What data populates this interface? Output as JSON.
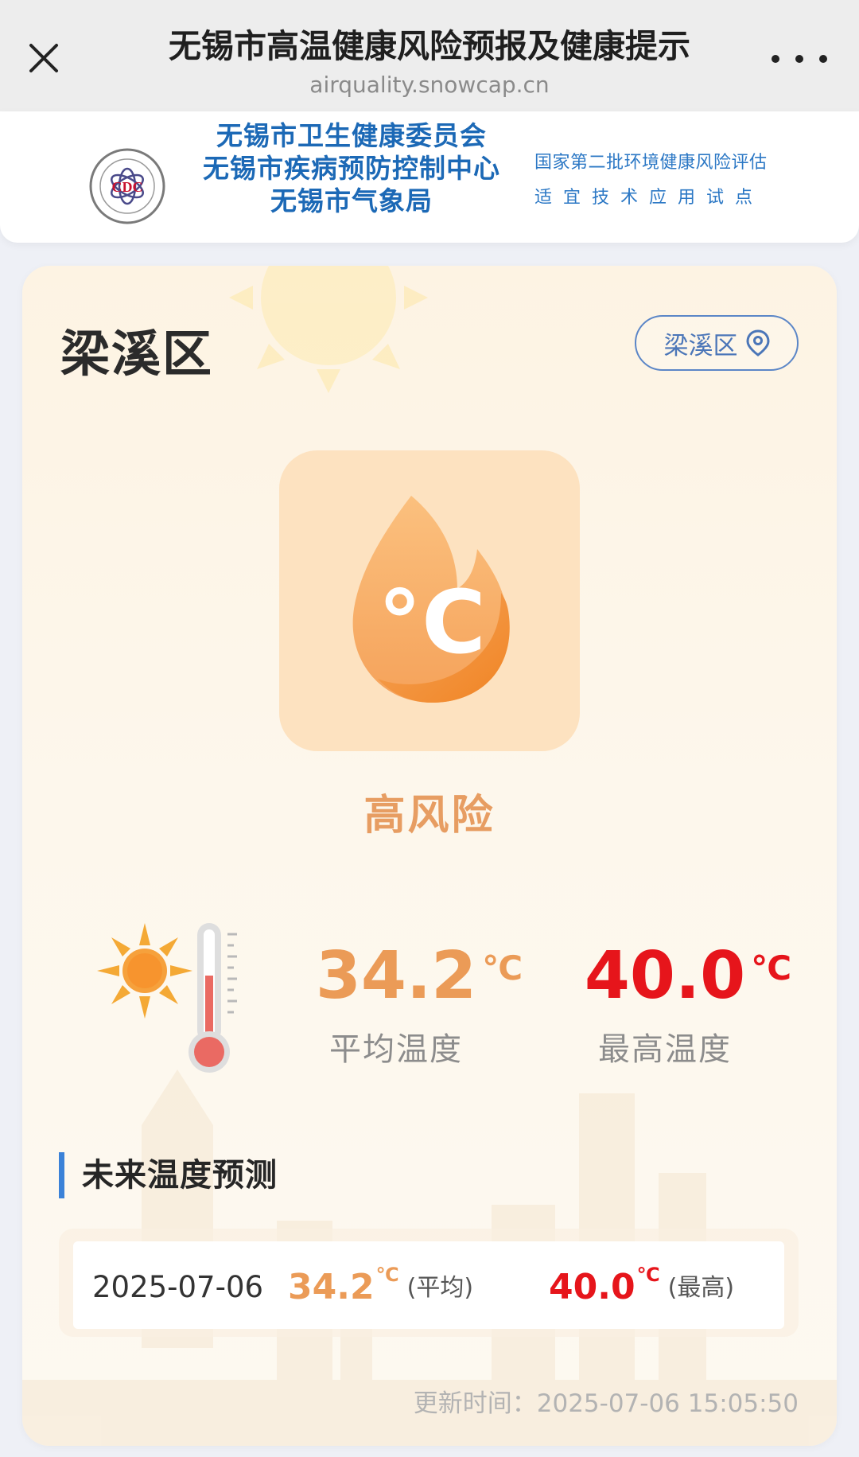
{
  "nav": {
    "title": "无锡市高温健康风险预报及健康提示",
    "url": "airquality.snowcap.cn"
  },
  "banner": {
    "orgs": [
      "无锡市卫生健康委员会",
      "无锡市疾病预防控制中心",
      "无锡市气象局"
    ],
    "pilot_line1": "国家第二批环境健康风险评估",
    "pilot_line2": "适宜技术应用试点",
    "logo_letters": "CDC"
  },
  "district": {
    "title": "梁溪区",
    "selector_label": "梁溪区"
  },
  "risk": {
    "level": "高风险",
    "icon_text": "°C"
  },
  "temps": {
    "avg_value": "34.2",
    "avg_unit": "℃",
    "avg_label": "平均温度",
    "max_value": "40.0",
    "max_unit": "℃",
    "max_label": "最高温度"
  },
  "forecast": {
    "heading": "未来温度预测",
    "rows": [
      {
        "date": "2025-07-06",
        "avg": "34.2",
        "avg_unit": "℃",
        "avg_tag": "(平均)",
        "max": "40.0",
        "max_unit": "℃",
        "max_tag": "(最高)"
      }
    ]
  },
  "update_time": "更新时间：2025-07-06 15:05:50",
  "colors": {
    "avg": "#eb9b57",
    "max": "#e6151b",
    "accent_blue": "#3b82d8",
    "risk": "#e79d62"
  }
}
